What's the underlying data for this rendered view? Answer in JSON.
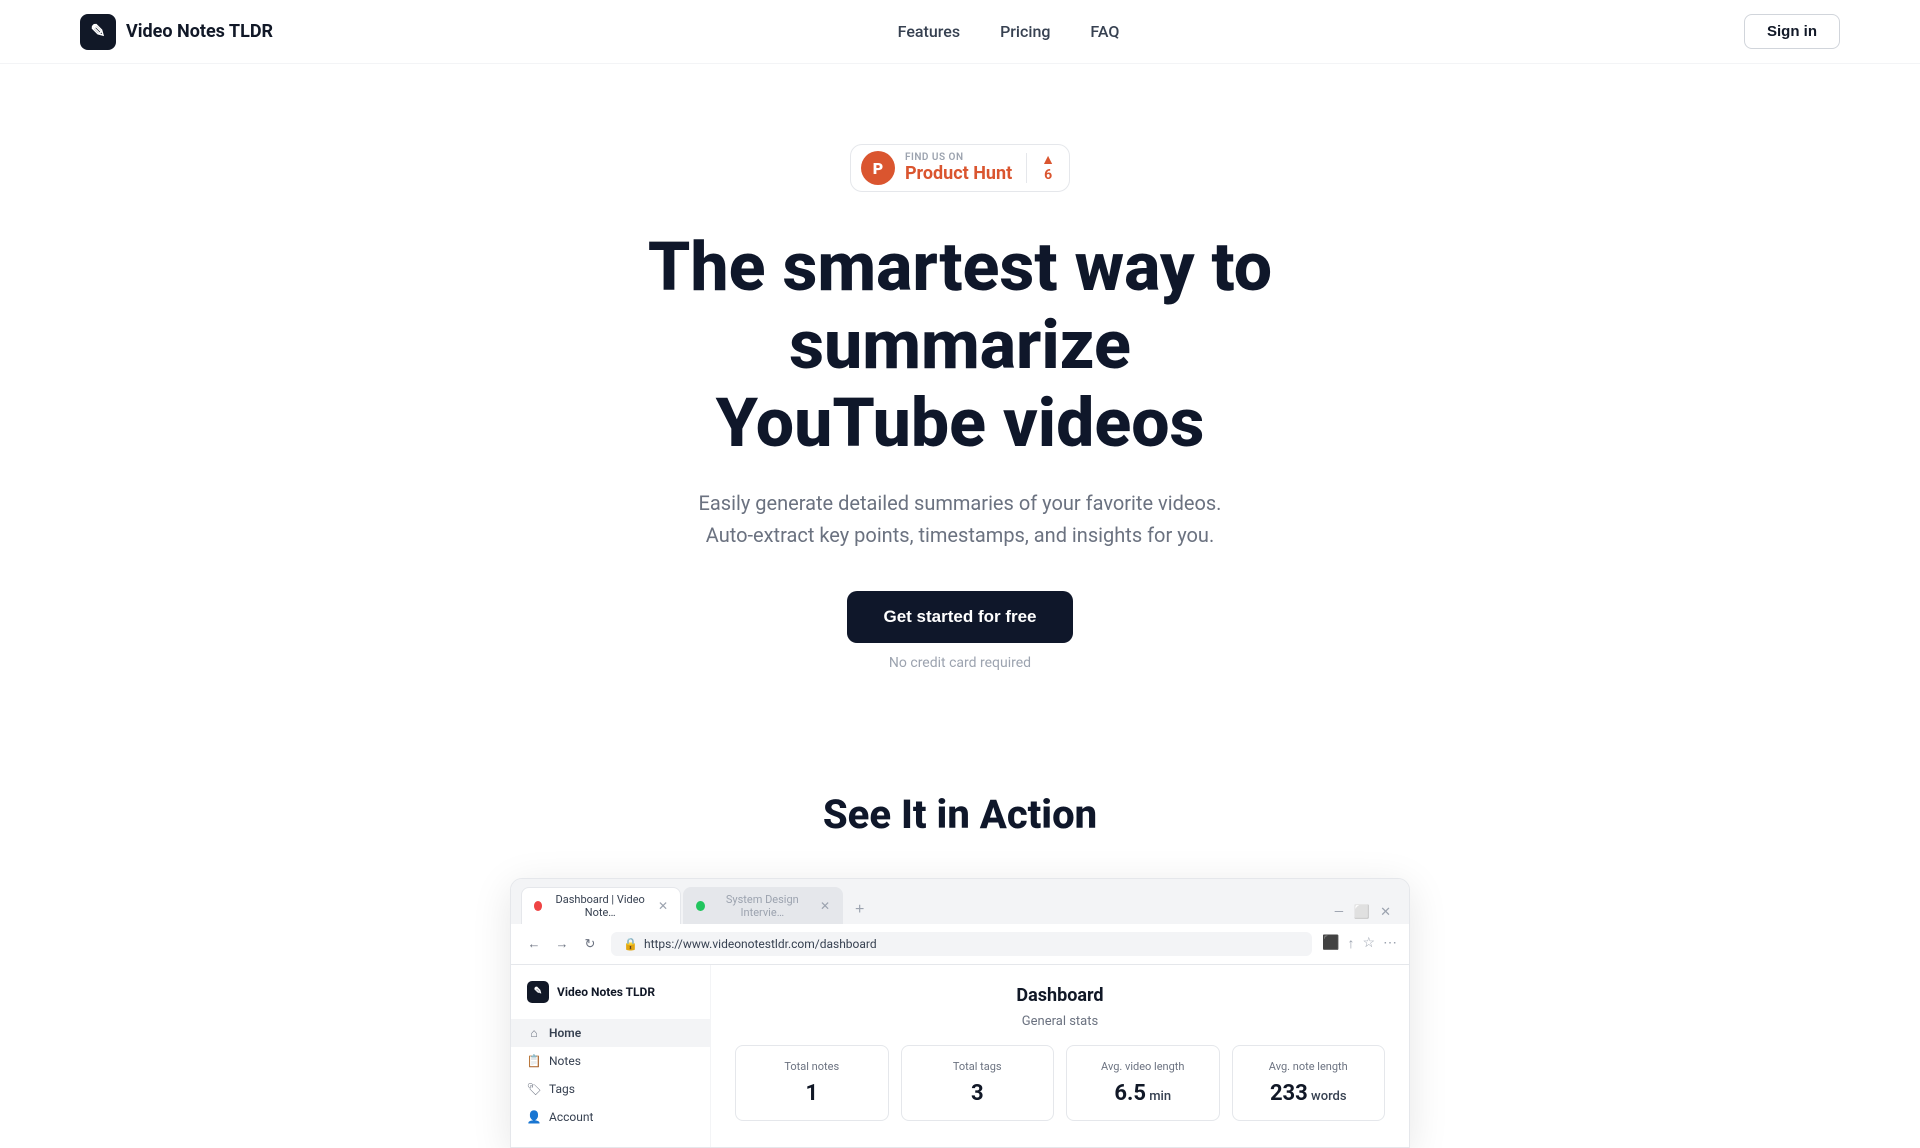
{
  "header": {
    "logo_icon": "✎",
    "logo_text": "Video Notes TLDR",
    "nav": [
      {
        "label": "Features",
        "href": "#"
      },
      {
        "label": "Pricing",
        "href": "#"
      },
      {
        "label": "FAQ",
        "href": "#"
      }
    ],
    "signin_label": "Sign in"
  },
  "product_hunt_badge": {
    "find_us_label": "FIND US ON",
    "name": "Product Hunt",
    "upvote_count": "6"
  },
  "hero": {
    "title_line1": "The smartest way to summarize",
    "title_line2": "YouTube videos",
    "subtitle": "Easily generate detailed summaries of your favorite videos. Auto-extract key points, timestamps, and insights for you.",
    "cta_label": "Get started for free",
    "no_cc_label": "No credit card required"
  },
  "action_section": {
    "title": "See It in Action"
  },
  "browser": {
    "tabs": [
      {
        "label": "Dashboard | Video Note…",
        "color": "red",
        "active": true
      },
      {
        "label": "System Design Intervie…",
        "color": "green",
        "active": false
      }
    ],
    "address": "https://www.videonotestldr.com/dashboard"
  },
  "dashboard": {
    "logo_icon": "✎",
    "logo_text": "Video Notes TLDR",
    "nav_items": [
      {
        "label": "Home",
        "icon": "⌂",
        "active": true
      },
      {
        "label": "Notes",
        "icon": "📋",
        "active": false
      },
      {
        "label": "Tags",
        "icon": "🏷",
        "active": false
      },
      {
        "label": "Account",
        "icon": "👤",
        "active": false
      }
    ],
    "main_title": "Dashboard",
    "stats_subtitle": "General stats",
    "stats": [
      {
        "label": "Total notes",
        "value": "1",
        "unit": ""
      },
      {
        "label": "Total tags",
        "value": "3",
        "unit": ""
      },
      {
        "label": "Avg. video length",
        "value": "6.5",
        "unit": " min"
      },
      {
        "label": "Avg. note length",
        "value": "233",
        "unit": " words"
      }
    ]
  }
}
